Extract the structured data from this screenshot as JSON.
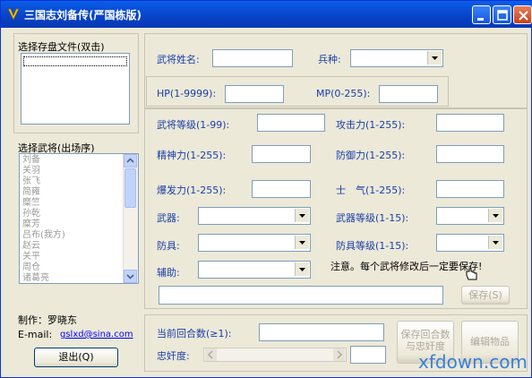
{
  "window": {
    "title": "三国志刘备传(严国栋版)",
    "accent": "#0a5ee8"
  },
  "left": {
    "save_file_label": "选择存盘文件(双击)",
    "general_list_label": "选择武将(出场序)",
    "generals": [
      "刘备",
      "关羽",
      "张飞",
      "简雍",
      "糜竺",
      "孙乾",
      "糜芳",
      "吕布(我方)",
      "赵云",
      "关平",
      "周仓",
      "诸葛亮"
    ],
    "author_label": "制作：罗晓东",
    "email_label": "E-mail:",
    "email_value": "gslxd@sina.com",
    "exit_button": "退出(Q)"
  },
  "form": {
    "name_label": "武将姓名:",
    "name_value": "",
    "troop_label": "兵种:",
    "troop_value": "",
    "hp_label": "HP(1-9999):",
    "hp_value": "",
    "mp_label": "MP(0-255):",
    "mp_value": "",
    "level_label": "武将等级(1-99):",
    "attack_label": "攻击力(1-255):",
    "spirit_label": "精神力(1-255):",
    "defense_label": "防御力(1-255):",
    "burst_label": "爆发力(1-255):",
    "morale_label": "士　气(1-255):",
    "weapon_label": "武器:",
    "weapon_level_label": "武器等级(1-15):",
    "armor_label": "防具:",
    "armor_level_label": "防具等级(1-15):",
    "aux_label": "辅助:",
    "notice": "注意。每个武将修改后一定要保存!",
    "save_button": "保存(S)"
  },
  "bottom": {
    "turn_label": "当前回合数(≥1):",
    "loyalty_label": "忠奸度:",
    "save_turn_button": "保存回合数与忠奸度",
    "edit_items_button": "编辑物品"
  },
  "watermark": "xfdown.com"
}
